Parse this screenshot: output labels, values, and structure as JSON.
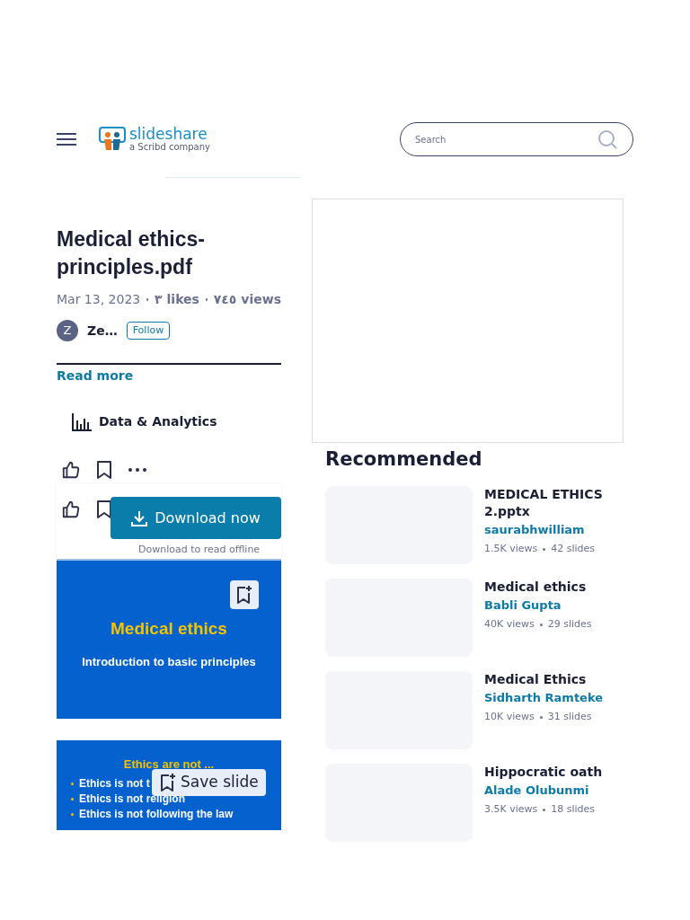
{
  "header": {
    "logo_name": "slideshare",
    "logo_tagline": "a Scribd company",
    "search": {
      "placeholder": "Search"
    }
  },
  "document": {
    "title": "Medical ethics-principles.pdf",
    "date": "Mar 13, 2023",
    "likes": "٣ likes",
    "views": "٧٤٥ views",
    "author_initial": "Z",
    "author": "Ze…",
    "follow": "Follow",
    "read_more": "Read more",
    "category": "Data & Analytics"
  },
  "download": {
    "button": "Download now",
    "caption": "Download to read offline"
  },
  "slides": [
    {
      "kind": "title",
      "heading": "Medical ethics",
      "subtitle": "Introduction to basic principles"
    },
    {
      "kind": "list",
      "heading": "Ethics are not ...",
      "bullets": [
        "Ethics is not t",
        "Ethics is not religion",
        "Ethics is not following the law"
      ],
      "save": "Save slide"
    }
  ],
  "recommended": {
    "title": "Recommended",
    "items": [
      {
        "title": "MEDICAL ETHICS 2.pptx",
        "author": "saurabhwilliam",
        "views": "1.5K views",
        "slides": "42 slides"
      },
      {
        "title": "Medical ethics",
        "author": "Babli Gupta",
        "views": "40K views",
        "slides": "29 slides"
      },
      {
        "title": "Medical Ethics",
        "author": "Sidharth Ramteke",
        "views": "10K views",
        "slides": "31 slides"
      },
      {
        "title": "Hippocratic oath",
        "author": "Alade Olubunmi",
        "views": "3.5K views",
        "slides": "18 slides"
      }
    ]
  }
}
